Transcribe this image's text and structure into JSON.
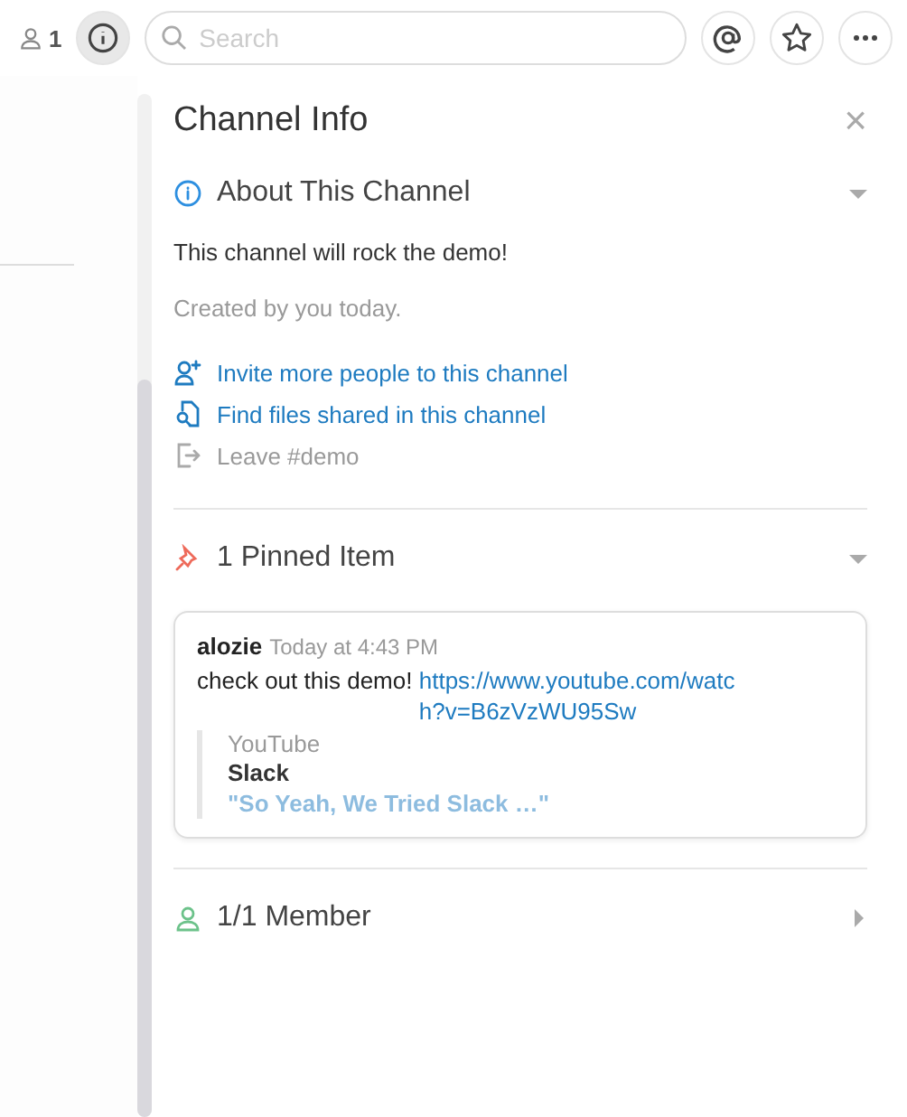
{
  "toolbar": {
    "member_count": "1",
    "info_selected": true,
    "search": {
      "placeholder": "Search"
    }
  },
  "panel": {
    "title": "Channel Info",
    "close": "×",
    "sections": [
      {
        "kind": "about",
        "title": "About This Channel",
        "expanded": true,
        "purpose": "This channel will rock the demo!",
        "created": "Created by you today.",
        "actions": [
          {
            "kind": "invite",
            "label": "Invite more people to this channel",
            "disabled": false
          },
          {
            "kind": "files",
            "label": "Find files shared in this channel",
            "disabled": false
          },
          {
            "kind": "leave",
            "label": "Leave #demo",
            "disabled": true
          }
        ]
      },
      {
        "kind": "pinned",
        "title": "1 Pinned Item",
        "expanded": true,
        "message": {
          "author": "alozie",
          "time": "Today at 4:43 PM",
          "text": "check out this demo!",
          "link": "https://www.youtube.com/watch?v=B6zVzWU95Sw",
          "attachment": {
            "service": "YouTube",
            "title": "Slack",
            "excerpt": "\"So Yeah, We Tried Slack …\""
          }
        }
      },
      {
        "kind": "members",
        "title": "1/1 Member",
        "expanded": false
      }
    ]
  }
}
